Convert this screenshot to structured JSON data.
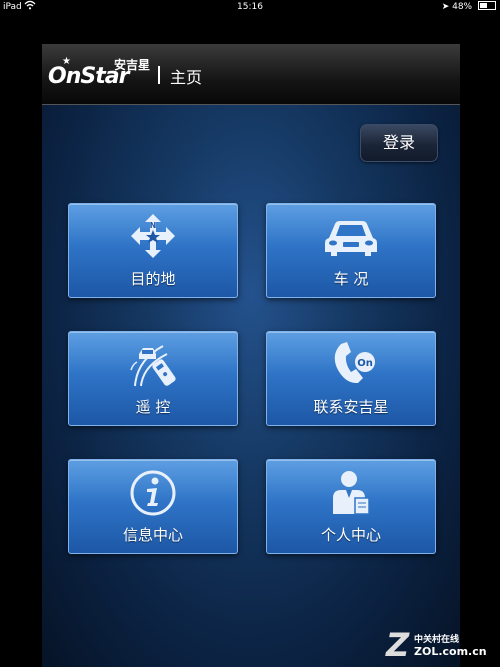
{
  "status_bar": {
    "device": "iPad",
    "time": "15:16",
    "battery_text": "48%",
    "battery_level": 0.48
  },
  "header": {
    "brand": "OnStar",
    "brand_cn": "安吉星",
    "title": "主页"
  },
  "login_label": "登录",
  "tiles": [
    {
      "label": "目的地",
      "icon": "destination-icon"
    },
    {
      "label": "车 况",
      "icon": "car-icon"
    },
    {
      "label": "遥 控",
      "icon": "remote-control-icon"
    },
    {
      "label": "联系安吉星",
      "icon": "phone-icon"
    },
    {
      "label": "信息中心",
      "icon": "info-icon"
    },
    {
      "label": "个人中心",
      "icon": "person-icon"
    }
  ],
  "watermark": {
    "letter": "Z",
    "line1": "中关村在线",
    "line2": "ZOL.com.cn"
  },
  "colors": {
    "tile": "#2f74c7",
    "background": "#0b2242"
  }
}
